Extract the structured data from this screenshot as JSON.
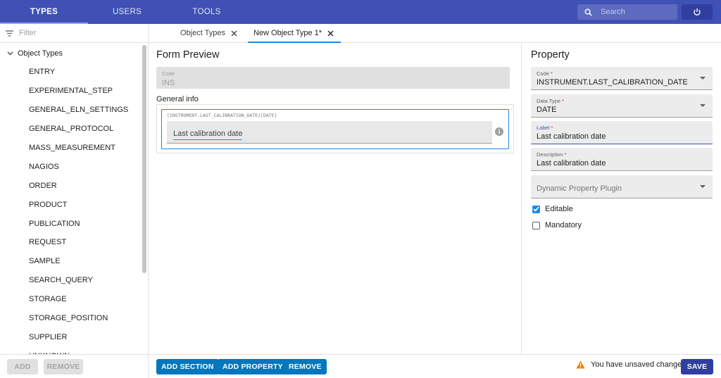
{
  "nav": {
    "tabs": [
      {
        "label": "TYPES",
        "active": true
      },
      {
        "label": "USERS",
        "active": false
      },
      {
        "label": "TOOLS",
        "active": false
      }
    ],
    "search_placeholder": "Search"
  },
  "sidebar": {
    "filter_placeholder": "Filter",
    "root_label": "Object Types",
    "items": [
      "ENTRY",
      "EXPERIMENTAL_STEP",
      "GENERAL_ELN_SETTINGS",
      "GENERAL_PROTOCOL",
      "MASS_MEASUREMENT",
      "NAGIOS",
      "ORDER",
      "PRODUCT",
      "PUBLICATION",
      "REQUEST",
      "SAMPLE",
      "SEARCH_QUERY",
      "STORAGE",
      "STORAGE_POSITION",
      "SUPPLIER",
      "UNKNOWN"
    ],
    "add_label": "ADD",
    "remove_label": "REMOVE"
  },
  "tabs": [
    {
      "label": "Object Types",
      "active": false
    },
    {
      "label": "New Object Type 1*",
      "active": true
    }
  ],
  "form_preview": {
    "title": "Form Preview",
    "code_label": "Code",
    "code_value": "INS",
    "section_title": "General info",
    "property_code": "[INSTRUMENT.LAST_CALIBRATION_DATE][DATE]",
    "property_value": "Last calibration date"
  },
  "footer": {
    "add_section": "ADD SECTION",
    "add_property": "ADD PROPERTY",
    "remove": "REMOVE",
    "unsaved": "You have unsaved changes",
    "save": "SAVE"
  },
  "property_panel": {
    "title": "Property",
    "code": {
      "label": "Code",
      "required": "*",
      "value": "INSTRUMENT.LAST_CALIBRATION_DATE"
    },
    "data_type": {
      "label": "Data Type",
      "required": "*",
      "value": "DATE"
    },
    "label_field": {
      "label": "Label",
      "required": "*",
      "value": "Last calibration date"
    },
    "description": {
      "label": "Description",
      "required": "*",
      "value": "Last calibration date"
    },
    "plugin_placeholder": "Dynamic Property Plugin",
    "editable": {
      "label": "Editable",
      "checked": true
    },
    "mandatory": {
      "label": "Mandatory",
      "checked": false
    }
  },
  "colors": {
    "appbar": "#3f51b5",
    "primary_button": "#0277bd",
    "save_button": "#303f9f",
    "warning": "#f57c00"
  }
}
